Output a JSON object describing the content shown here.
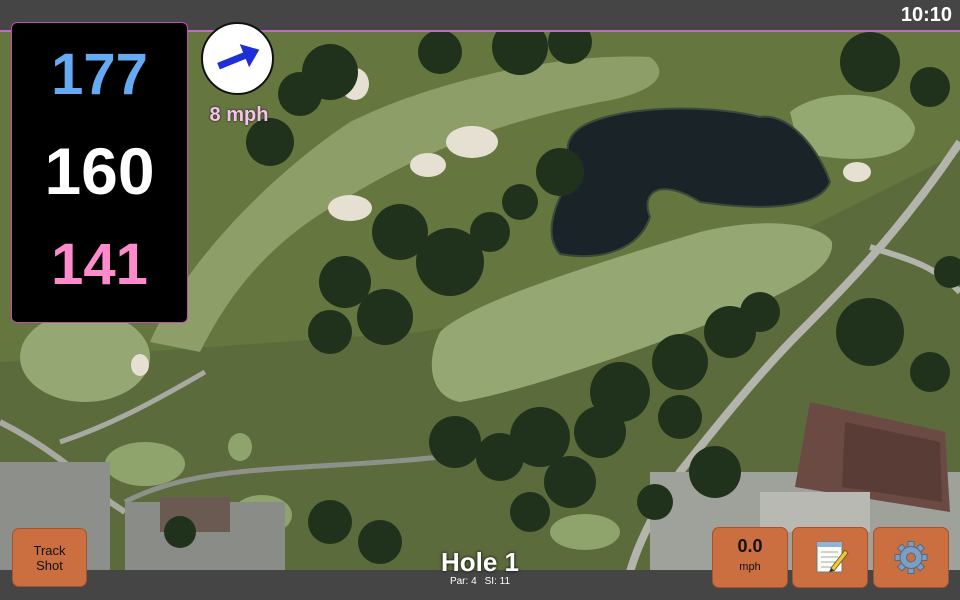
{
  "status": {
    "time": "10:10"
  },
  "yardages": {
    "back": "177",
    "middle": "160",
    "front": "141"
  },
  "wind": {
    "speed": "8 mph",
    "icon": "wind-arrow-icon",
    "arrow_color": "#1f2fd8"
  },
  "hole": {
    "title": "Hole 1",
    "par": "Par: 4",
    "si": "SI: 11"
  },
  "buttons": {
    "track_shot": "Track\nShot",
    "speed_value": "0.0",
    "speed_unit": "mph",
    "notes_icon": "notepad-icon",
    "settings_icon": "gear-icon"
  },
  "colors": {
    "back_yardage": "#66aaf3",
    "mid_yardage": "#ffffff",
    "front_yardage": "#ff8bcd",
    "button_bg": "#cc6f40",
    "panel_border": "#c14db8"
  }
}
